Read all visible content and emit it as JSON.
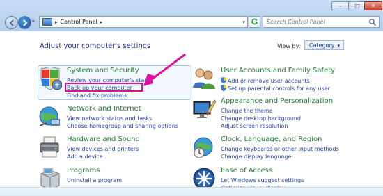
{
  "window": {
    "controls": {
      "minimize": "–",
      "maximize": "□",
      "close": "✕"
    }
  },
  "address_bar": {
    "icon": "control-panel-icon",
    "separator": "▸",
    "path": "Control Panel",
    "path_separator": "▸",
    "dropdown": "▾"
  },
  "search": {
    "placeholder": "Search Control Panel",
    "icon": "search-icon"
  },
  "main": {
    "heading": "Adjust your computer's settings",
    "view_by": {
      "label": "View by:",
      "value": "Category",
      "arrow": "▾"
    }
  },
  "categories": [
    {
      "title": "System and Security",
      "icon": "system-security-icon",
      "links": [
        "Review your computer's status",
        "Back up your computer",
        "Find and fix problems"
      ]
    },
    {
      "title": "Network and Internet",
      "icon": "network-globe-icon",
      "links": [
        "View network status and tasks",
        "Choose homegroup and sharing options"
      ]
    },
    {
      "title": "Hardware and Sound",
      "icon": "printer-icon",
      "links": [
        "View devices and printers",
        "Add a device"
      ]
    },
    {
      "title": "Programs",
      "icon": "programs-box-icon",
      "links": [
        "Uninstall a program"
      ]
    },
    {
      "title": "User Accounts and Family Safety",
      "icon": "users-icon",
      "links": [
        "Add or remove user accounts",
        "Set up parental controls for any user"
      ]
    },
    {
      "title": "Appearance and Personalization",
      "icon": "monitor-paint-icon",
      "links": [
        "Change the theme",
        "Change desktop background",
        "Adjust screen resolution"
      ]
    },
    {
      "title": "Clock, Language, and Region",
      "icon": "clock-globe-icon",
      "links": [
        "Change keyboards or other input methods",
        "Change display language"
      ]
    },
    {
      "title": "Ease of Access",
      "icon": "ease-of-access-icon",
      "links": [
        "Let Windows suggest settings",
        "Optimize visual display"
      ]
    }
  ],
  "annotation": {
    "color": "#e0109e",
    "target": "Back up your computer"
  },
  "colors": {
    "link": "#1e3fa8",
    "category_title": "#1e7a2a",
    "heading": "#1e3287"
  }
}
